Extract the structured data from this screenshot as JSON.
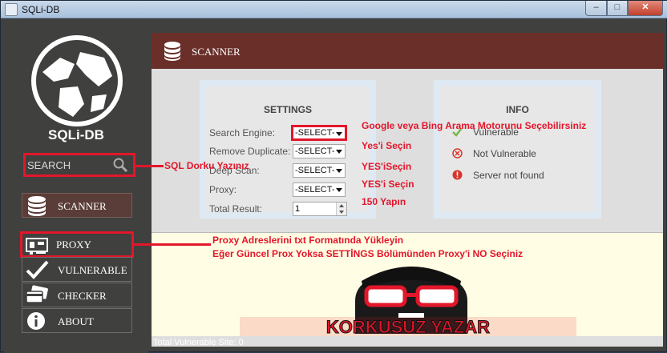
{
  "window": {
    "title": "SQLi-DB",
    "min": "–",
    "max": "□",
    "close": "✕"
  },
  "sidebar": {
    "logo_text": "SQLi-DB",
    "search": {
      "placeholder": "SEARCH"
    },
    "items": [
      {
        "label": "SCANNER",
        "icon": "database-icon"
      },
      {
        "label": "PROXY",
        "icon": "network-card-icon"
      },
      {
        "label": "VULNERABLE",
        "icon": "checkmark-icon"
      },
      {
        "label": "CHECKER",
        "icon": "cards-icon"
      },
      {
        "label": "ABOUT",
        "icon": "info-icon"
      }
    ]
  },
  "panel": {
    "title": "SCANNER"
  },
  "settings": {
    "title": "SETTINGS",
    "fields": [
      {
        "label": "Search Engine:",
        "value": "-SELECT-"
      },
      {
        "label": "Remove Duplicate:",
        "value": "-SELECT-"
      },
      {
        "label": "Deep Scan:",
        "value": "-SELECT-"
      },
      {
        "label": "Proxy:",
        "value": "-SELECT-"
      },
      {
        "label": "Total Result:",
        "value": "1"
      }
    ]
  },
  "info": {
    "title": "INFO",
    "rows": [
      {
        "text": "Vulnerable",
        "color": "#7ab648"
      },
      {
        "text": "Not Vulnerable",
        "color": "#d9342b"
      },
      {
        "text": "Server not found",
        "color": "#d9342b"
      }
    ]
  },
  "annotations": {
    "search_engine": "Google veya Bing Arama Motorunu Seçebilirsiniz",
    "remove_dup": "Yes'i Seçin",
    "deep_scan": "YES'iSeçin",
    "proxy": "YES'i Seçin",
    "total": "150 Yapın",
    "search": "SQL Dorku Yazınız",
    "proxy_line1": "Proxy Adreslerini txt Formatında Yükleyin",
    "proxy_line2": "Eğer Güncel Prox Yoksa SETTİNGS Bölümünden Proxy'i NO Seçiniz"
  },
  "banner": {
    "text": "KORKUSUZ YAZAR"
  },
  "status": {
    "text": "Total Vulnerable Site:  0"
  },
  "colors": {
    "accent": "#6b2f2a",
    "annotation": "#e3162a",
    "sidebar": "#40403f",
    "preview": "#fffde4"
  }
}
